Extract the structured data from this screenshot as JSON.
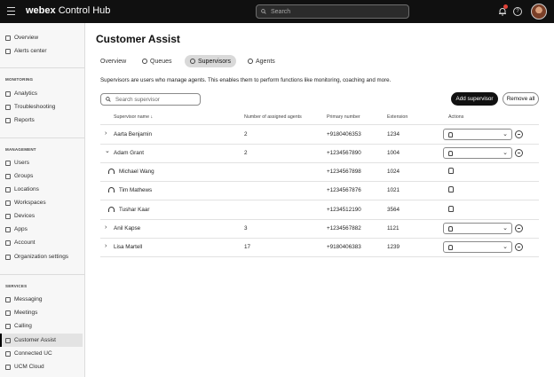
{
  "header": {
    "brand_bold": "webex",
    "brand_rest": " Control Hub",
    "search_placeholder": "Search",
    "colors": {
      "bar": "#101010",
      "badge": "#e0443a"
    }
  },
  "sidebar": {
    "top_items": [
      {
        "label": "Overview",
        "icon": "home-icon"
      },
      {
        "label": "Alerts center",
        "icon": "bell-icon"
      }
    ],
    "monitoring_title": "MONITORING",
    "monitoring_items": [
      {
        "label": "Analytics",
        "icon": "chart-icon"
      },
      {
        "label": "Troubleshooting",
        "icon": "wrench-icon"
      },
      {
        "label": "Reports",
        "icon": "report-icon"
      }
    ],
    "management_title": "MANAGEMENT",
    "management_items": [
      {
        "label": "Users",
        "icon": "user-icon"
      },
      {
        "label": "Groups",
        "icon": "groups-icon"
      },
      {
        "label": "Locations",
        "icon": "location-icon"
      },
      {
        "label": "Workspaces",
        "icon": "workspace-icon"
      },
      {
        "label": "Devices",
        "icon": "device-icon"
      },
      {
        "label": "Apps",
        "icon": "apps-icon"
      },
      {
        "label": "Account",
        "icon": "account-icon"
      },
      {
        "label": "Organization settings",
        "icon": "settings-icon"
      }
    ],
    "services_title": "SERVICES",
    "services_items": [
      {
        "label": "Messaging",
        "icon": "message-icon"
      },
      {
        "label": "Meetings",
        "icon": "meetings-icon"
      },
      {
        "label": "Calling",
        "icon": "phone-icon"
      },
      {
        "label": "Customer Assist",
        "icon": "customer-assist-icon",
        "active": true
      },
      {
        "label": "Connected UC",
        "icon": "connected-uc-icon"
      },
      {
        "label": "UCM Cloud",
        "icon": "cloud-icon"
      }
    ]
  },
  "main": {
    "title": "Customer Assist",
    "tabs": [
      {
        "label": "Overview"
      },
      {
        "label": "Queues"
      },
      {
        "label": "Supervisors",
        "active": true
      },
      {
        "label": "Agents"
      }
    ],
    "description": "Supervisors are users who manage agents. This enables them to perform functions like monitoring, coaching and more.",
    "search_placeholder": "Search supervisor",
    "add_button": "Add supervisor",
    "remove_button": "Remove all",
    "columns": {
      "name": "Supervisor name",
      "sort_arrow": "↓",
      "agents": "Number of assigned agents",
      "primary": "Primary number",
      "extension": "Extension",
      "actions": "Actions"
    },
    "rows": [
      {
        "type": "supervisor",
        "expanded": false,
        "name": "Aarta Benjamin",
        "agents": "2",
        "primary": "+9180406353",
        "extension": "1234"
      },
      {
        "type": "supervisor",
        "expanded": true,
        "name": "Adam Grant",
        "agents": "2",
        "primary": "+1234567890",
        "extension": "1004"
      },
      {
        "type": "agent",
        "name": "Michael Wang",
        "primary": "+1234567898",
        "extension": "1024"
      },
      {
        "type": "agent",
        "name": "Tim Mathews",
        "primary": "+1234567876",
        "extension": "1021"
      },
      {
        "type": "agent",
        "name": "Tushar Kaar",
        "primary": "+1234512190",
        "extension": "3564"
      },
      {
        "type": "supervisor",
        "expanded": false,
        "name": "Anil Kapse",
        "agents": "3",
        "primary": "+1234567882",
        "extension": "1121"
      },
      {
        "type": "supervisor",
        "expanded": false,
        "name": "Lisa Martell",
        "agents": "17",
        "primary": "+9180406383",
        "extension": "1239"
      }
    ]
  }
}
